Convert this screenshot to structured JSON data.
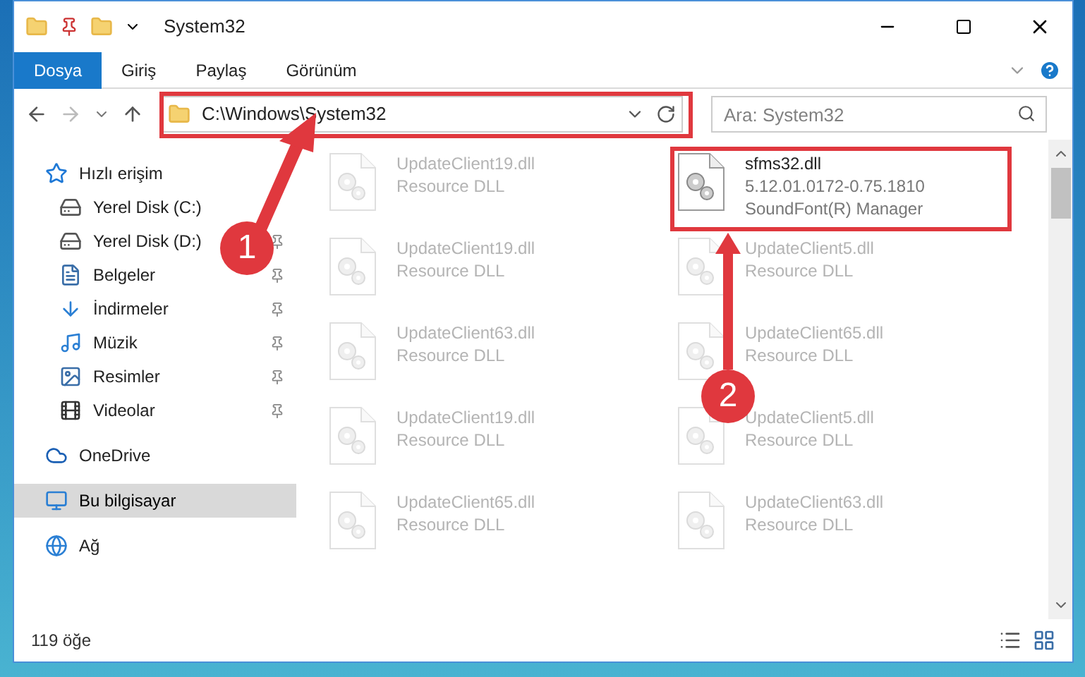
{
  "window": {
    "title": "System32"
  },
  "ribbon_tabs": [
    {
      "label": "Dosya",
      "selected": true
    },
    {
      "label": "Giriş",
      "selected": false
    },
    {
      "label": "Paylaş",
      "selected": false
    },
    {
      "label": "Görünüm",
      "selected": false
    }
  ],
  "address": {
    "path": "C:\\Windows\\System32"
  },
  "search": {
    "placeholder": "Ara: System32"
  },
  "sidebar": {
    "items": [
      {
        "label": "Hızlı erişim",
        "pinned": false,
        "selected": false
      },
      {
        "label": "Yerel Disk (C:)",
        "pinned": false,
        "selected": false
      },
      {
        "label": "Yerel Disk (D:)",
        "pinned": true,
        "selected": false
      },
      {
        "label": "Belgeler",
        "pinned": true,
        "selected": false
      },
      {
        "label": "İndirmeler",
        "pinned": true,
        "selected": false
      },
      {
        "label": "Müzik",
        "pinned": true,
        "selected": false
      },
      {
        "label": "Resimler",
        "pinned": true,
        "selected": false
      },
      {
        "label": "Videolar",
        "pinned": true,
        "selected": false
      },
      {
        "label": "OneDrive",
        "pinned": false,
        "selected": false
      },
      {
        "label": "Bu bilgisayar",
        "pinned": false,
        "selected": true
      },
      {
        "label": "Ağ",
        "pinned": false,
        "selected": false
      }
    ]
  },
  "files": [
    {
      "lines": [
        "UpdateClient19.dll",
        "Resource DLL"
      ],
      "faded": true
    },
    {
      "lines": [
        "sfms32.dll",
        "5.12.01.0172-0.75.1810",
        "SoundFont(R) Manager"
      ],
      "faded": false
    },
    {
      "lines": [
        "UpdateClient19.dll",
        "Resource DLL"
      ],
      "faded": true
    },
    {
      "lines": [
        "UpdateClient5.dll",
        "Resource DLL"
      ],
      "faded": true
    },
    {
      "lines": [
        "UpdateClient63.dll",
        "Resource DLL"
      ],
      "faded": true
    },
    {
      "lines": [
        "UpdateClient65.dll",
        "Resource DLL"
      ],
      "faded": true
    },
    {
      "lines": [
        "UpdateClient19.dll",
        "Resource DLL"
      ],
      "faded": true
    },
    {
      "lines": [
        "UpdateClient5.dll",
        "Resource DLL"
      ],
      "faded": true
    },
    {
      "lines": [
        "UpdateClient65.dll",
        "Resource DLL"
      ],
      "faded": true
    },
    {
      "lines": [
        "UpdateClient63.dll",
        "Resource DLL"
      ],
      "faded": true
    }
  ],
  "status_bar": {
    "count": "119 öğe"
  },
  "annotations": [
    {
      "label": "1"
    },
    {
      "label": "2"
    }
  ]
}
